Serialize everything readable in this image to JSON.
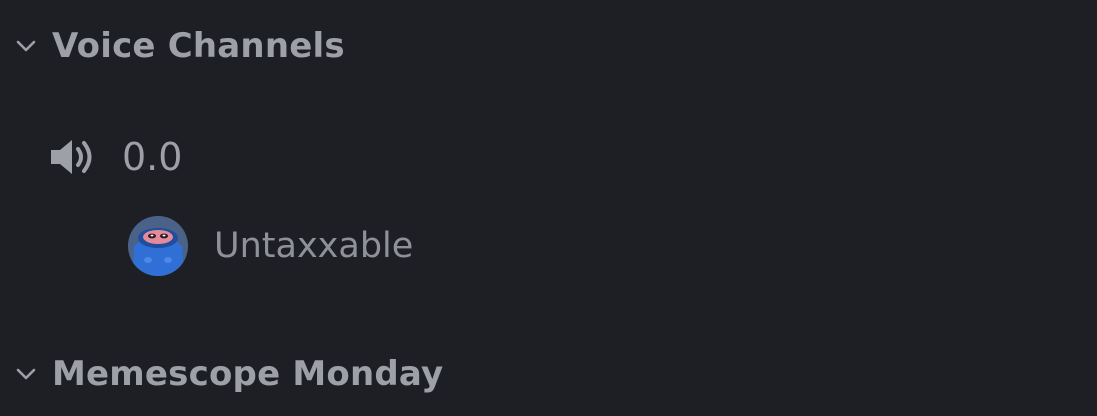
{
  "sidebar": {
    "categories": [
      {
        "label": "Voice Channels",
        "icon": "chevron-down-icon"
      },
      {
        "label": "Memescope Monday",
        "icon": "chevron-down-icon"
      }
    ],
    "voice_channel": {
      "name": "0.0",
      "icon": "speaker-icon",
      "members": [
        {
          "username": "Untaxxable",
          "avatar": "pepe-avatar"
        }
      ]
    }
  },
  "colors": {
    "background": "#1e1f24",
    "text_muted": "#9ea0a8"
  }
}
